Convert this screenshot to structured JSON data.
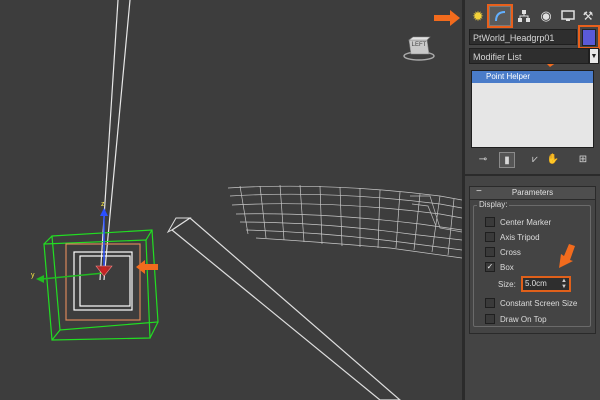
{
  "viewport": {
    "viewcube_label": "LEFT"
  },
  "command_panel": {
    "tabs": [
      {
        "name": "create",
        "icon": "sun-create-icon"
      },
      {
        "name": "modify",
        "icon": "modify-bend-icon",
        "active": true
      },
      {
        "name": "hierarchy",
        "icon": "hierarchy-icon"
      },
      {
        "name": "motion",
        "icon": "motion-icon"
      },
      {
        "name": "display",
        "icon": "display-monitor-icon"
      },
      {
        "name": "utilities",
        "icon": "hammer-icon"
      }
    ],
    "object_name": "PtWorld_Headgrp01",
    "object_color": "#5a5ad8",
    "modifier_list_label": "Modifier List",
    "stack_items": [
      "Point Helper"
    ],
    "parameters": {
      "rollout_title": "Parameters",
      "display_group_label": "Display:",
      "options": [
        {
          "label": "Center Marker",
          "checked": false
        },
        {
          "label": "Axis Tripod",
          "checked": false
        },
        {
          "label": "Cross",
          "checked": false
        },
        {
          "label": "Box",
          "checked": true
        }
      ],
      "size_label": "Size:",
      "size_value": "5.0cm",
      "extra_options": [
        {
          "label": "Constant Screen Size",
          "checked": false
        },
        {
          "label": "Draw On Top",
          "checked": false
        }
      ]
    }
  },
  "colors": {
    "highlight": "#e8601c",
    "selection": "#4a7cc9"
  }
}
